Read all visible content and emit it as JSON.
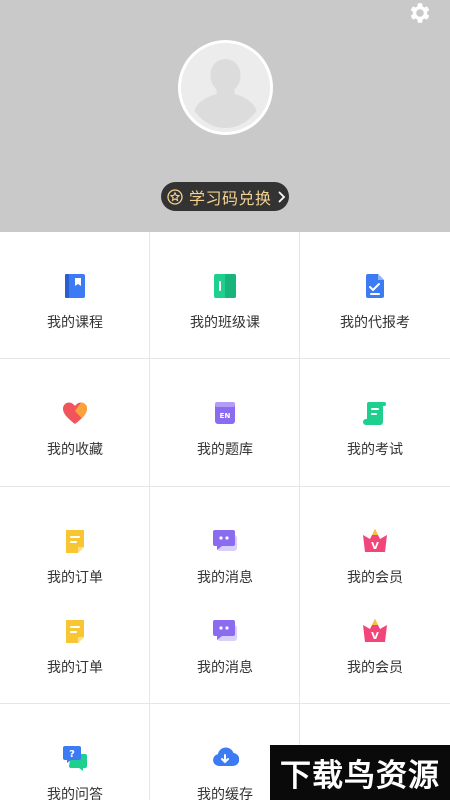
{
  "profile": {
    "redeem_label": "学习码兑换"
  },
  "menu": [
    {
      "label": "我的课程",
      "icon": "course-book-icon"
    },
    {
      "label": "我的班级课",
      "icon": "class-book-icon"
    },
    {
      "label": "我的代报考",
      "icon": "exam-registration-icon"
    },
    {
      "label": "我的收藏",
      "icon": "heart-favorite-icon"
    },
    {
      "label": "我的题库",
      "icon": "question-bank-icon"
    },
    {
      "label": "我的考试",
      "icon": "exam-scroll-icon"
    },
    {
      "label": "我的订单",
      "icon": "order-note-icon"
    },
    {
      "label": "我的消息",
      "icon": "message-chat-icon"
    },
    {
      "label": "我的会员",
      "icon": "vip-crown-icon"
    },
    {
      "label": "我的订单",
      "icon": "order-note-icon"
    },
    {
      "label": "我的消息",
      "icon": "message-chat-icon"
    },
    {
      "label": "我的会员",
      "icon": "vip-crown-icon"
    },
    {
      "label": "我的问答",
      "icon": "qa-bubble-icon"
    },
    {
      "label": "我的缓存",
      "icon": "cloud-download-icon"
    }
  ],
  "watermark": "下载鸟资源",
  "colors": {
    "header_bg": "#c9c9c9",
    "redeem_bg": "#333333",
    "redeem_text": "#f3d291",
    "blue": "#3d7bf4",
    "green": "#1fcf8e",
    "red": "#f2545b",
    "purple": "#8b6cf0",
    "yellow": "#f8c533",
    "pink": "#f2457a"
  }
}
